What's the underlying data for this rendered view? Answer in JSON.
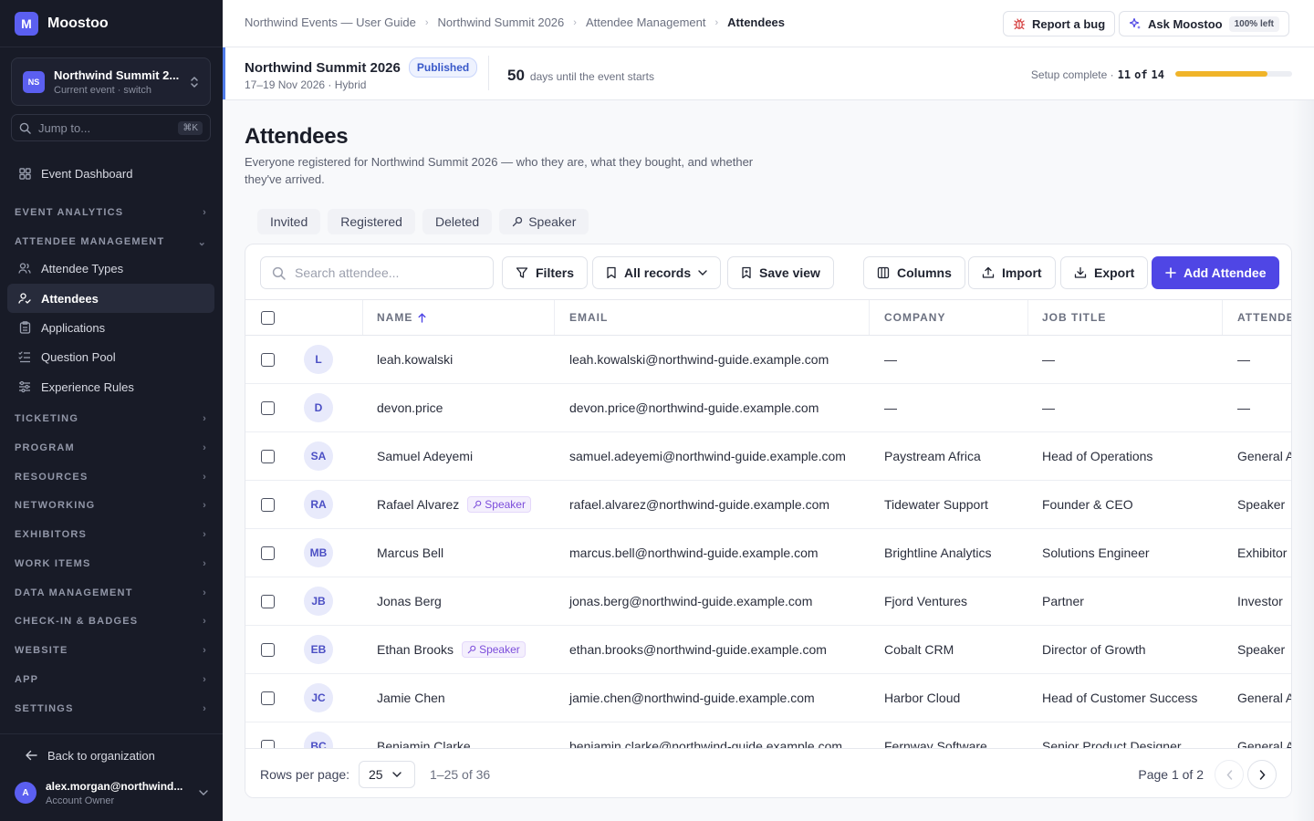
{
  "app": {
    "logo_letter": "M",
    "name": "Moostoo"
  },
  "event_switcher": {
    "badge": "NS",
    "title": "Northwind Summit 2...",
    "subtitle": "Current event · switch"
  },
  "jump": {
    "placeholder": "Jump to...",
    "shortcut": "⌘K"
  },
  "sidebar": {
    "dashboard": "Event Dashboard",
    "sections": {
      "event_analytics": "EVENT ANALYTICS",
      "attendee_management": "ATTENDEE MANAGEMENT",
      "ticketing": "TICKETING",
      "program": "PROGRAM",
      "resources": "RESOURCES",
      "networking": "NETWORKING",
      "exhibitors": "EXHIBITORS",
      "work_items": "WORK ITEMS",
      "data_management": "DATA MANAGEMENT",
      "checkin": "CHECK-IN & BADGES",
      "website": "WEBSITE",
      "app": "APP",
      "settings": "SETTINGS"
    },
    "attendee_items": [
      "Attendee Types",
      "Attendees",
      "Applications",
      "Question Pool",
      "Experience Rules"
    ],
    "back": "Back to organization",
    "user": {
      "initial": "A",
      "email": "alex.morgan@northwind...",
      "role": "Account Owner"
    }
  },
  "breadcrumbs": [
    "Northwind Events — User Guide",
    "Northwind Summit 2026",
    "Attendee Management",
    "Attendees"
  ],
  "top_actions": {
    "report_bug": "Report a bug",
    "ask": "Ask Moostoo",
    "ask_badge": "100% left"
  },
  "event_bar": {
    "name": "Northwind Summit 2026",
    "status": "Published",
    "meta": "17–19 Nov 2026 · Hybrid",
    "days": "50",
    "days_label": "days until the event starts",
    "setup_label": "Setup complete ·",
    "setup_done": "11",
    "setup_of": "of",
    "setup_total": "14",
    "setup_progress": 0.786
  },
  "page": {
    "title": "Attendees",
    "description": "Everyone registered for Northwind Summit 2026 — who they are, what they bought, and whether they've arrived."
  },
  "tabs": [
    "Invited",
    "Registered",
    "Deleted",
    "Speaker"
  ],
  "toolbar": {
    "search_placeholder": "Search attendee...",
    "filters": "Filters",
    "records": "All records",
    "save_view": "Save view",
    "columns": "Columns",
    "import": "Import",
    "export": "Export",
    "add": "Add Attendee"
  },
  "table": {
    "headers": {
      "name": "NAME",
      "email": "EMAIL",
      "company": "COMPANY",
      "job": "JOB TITLE",
      "type": "ATTENDE"
    },
    "speaker_badge": "Speaker",
    "rows": [
      {
        "initials": "L",
        "name": "leah.kowalski",
        "speaker": false,
        "email": "leah.kowalski@northwind-guide.example.com",
        "company": "—",
        "job": "—",
        "type": "—"
      },
      {
        "initials": "D",
        "name": "devon.price",
        "speaker": false,
        "email": "devon.price@northwind-guide.example.com",
        "company": "—",
        "job": "—",
        "type": "—"
      },
      {
        "initials": "SA",
        "name": "Samuel Adeyemi",
        "speaker": false,
        "email": "samuel.adeyemi@northwind-guide.example.com",
        "company": "Paystream Africa",
        "job": "Head of Operations",
        "type": "General A"
      },
      {
        "initials": "RA",
        "name": "Rafael Alvarez",
        "speaker": true,
        "email": "rafael.alvarez@northwind-guide.example.com",
        "company": "Tidewater Support",
        "job": "Founder & CEO",
        "type": "Speaker"
      },
      {
        "initials": "MB",
        "name": "Marcus Bell",
        "speaker": false,
        "email": "marcus.bell@northwind-guide.example.com",
        "company": "Brightline Analytics",
        "job": "Solutions Engineer",
        "type": "Exhibitor"
      },
      {
        "initials": "JB",
        "name": "Jonas Berg",
        "speaker": false,
        "email": "jonas.berg@northwind-guide.example.com",
        "company": "Fjord Ventures",
        "job": "Partner",
        "type": "Investor"
      },
      {
        "initials": "EB",
        "name": "Ethan Brooks",
        "speaker": true,
        "email": "ethan.brooks@northwind-guide.example.com",
        "company": "Cobalt CRM",
        "job": "Director of Growth",
        "type": "Speaker"
      },
      {
        "initials": "JC",
        "name": "Jamie Chen",
        "speaker": false,
        "email": "jamie.chen@northwind-guide.example.com",
        "company": "Harbor Cloud",
        "job": "Head of Customer Success",
        "type": "General A"
      },
      {
        "initials": "BC",
        "name": "Benjamin Clarke",
        "speaker": false,
        "email": "benjamin.clarke@northwind-guide.example.com",
        "company": "Fernway Software",
        "job": "Senior Product Designer",
        "type": "General A"
      }
    ]
  },
  "pagination": {
    "rows_label": "Rows per page:",
    "rows_value": "25",
    "range": "1–25 of 36",
    "page": "Page 1 of 2"
  },
  "colors": {
    "accent": "#4f46e5",
    "sidebar_bg": "#181b27",
    "progress": "#f0b429",
    "published": "#3858c9"
  }
}
